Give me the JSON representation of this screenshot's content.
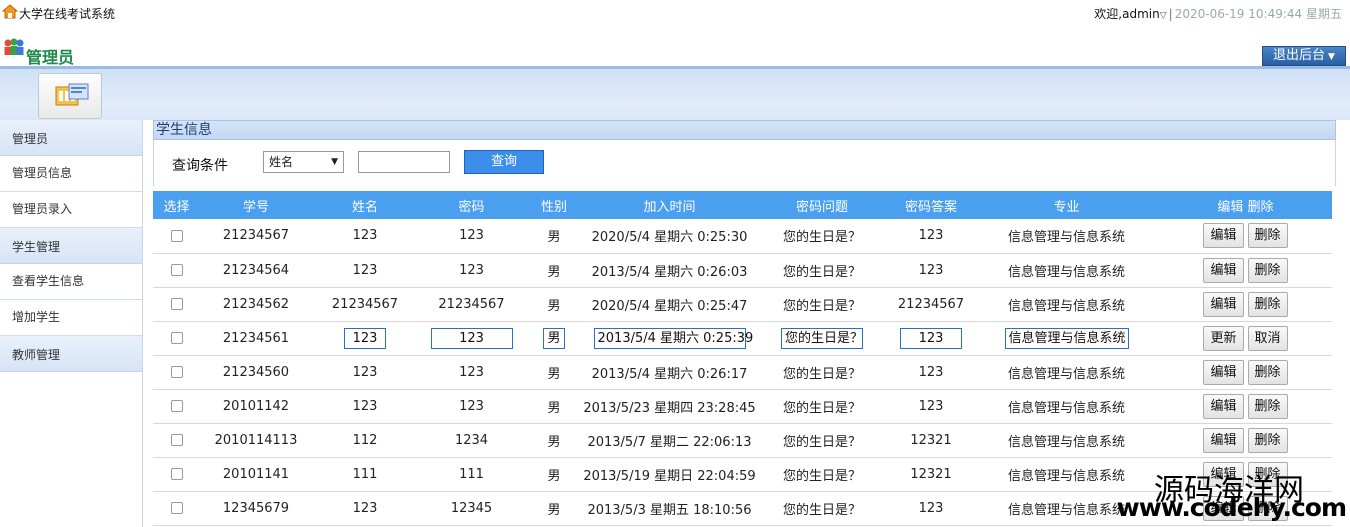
{
  "topbar": {
    "system_title": "大学在线考试系统",
    "welcome": "欢迎,",
    "username": "admin",
    "separator": "|",
    "datetime": "2020-06-19 10:49:44",
    "weekday": "星期五"
  },
  "header": {
    "role_title": "管理员",
    "logout_label": "退出后台"
  },
  "sidebar": {
    "groups": [
      {
        "label": "管理员",
        "items": [
          "管理员信息",
          "管理员录入"
        ]
      },
      {
        "label": "学生管理",
        "items": [
          "查看学生信息",
          "增加学生"
        ]
      },
      {
        "label": "教师管理",
        "items": []
      }
    ]
  },
  "panel": {
    "title": "学生信息",
    "query_label": "查询条件",
    "query_field_selected": "姓名",
    "query_value": "",
    "query_button": "查询"
  },
  "table": {
    "columns": [
      "选择",
      "学号",
      "姓名",
      "密码",
      "性别",
      "加入时间",
      "密码问题",
      "密码答案",
      "专业",
      "编辑 删除"
    ],
    "edit_label": "编辑",
    "delete_label": "删除",
    "update_label": "更新",
    "cancel_label": "取消",
    "rows": [
      {
        "id": "21234567",
        "name": "123",
        "password": "123",
        "gender": "男",
        "joined": "2020/5/4 星期六 0:25:30",
        "question": "您的生日是？",
        "answer": "123",
        "major": "信息管理与信息系统",
        "editing": false
      },
      {
        "id": "21234564",
        "name": "123",
        "password": "123",
        "gender": "男",
        "joined": "2013/5/4 星期六 0:26:03",
        "question": "您的生日是？",
        "answer": "123",
        "major": "信息管理与信息系统",
        "editing": false
      },
      {
        "id": "21234562",
        "name": "21234567",
        "password": "21234567",
        "gender": "男",
        "joined": "2020/5/4 星期六 0:25:47",
        "question": "您的生日是？",
        "answer": "21234567",
        "major": "信息管理与信息系统",
        "editing": false
      },
      {
        "id": "21234561",
        "name": "123",
        "password": "123",
        "gender": "男",
        "joined": "2013/5/4 星期六 0:25:39",
        "question": "您的生日是？",
        "answer": "123",
        "major": "信息管理与信息系统",
        "editing": true
      },
      {
        "id": "21234560",
        "name": "123",
        "password": "123",
        "gender": "男",
        "joined": "2013/5/4 星期六 0:26:17",
        "question": "您的生日是？",
        "answer": "123",
        "major": "信息管理与信息系统",
        "editing": false
      },
      {
        "id": "20101142",
        "name": "123",
        "password": "123",
        "gender": "男",
        "joined": "2013/5/23 星期四 23:28:45",
        "question": "您的生日是？",
        "answer": "123",
        "major": "信息管理与信息系统",
        "editing": false
      },
      {
        "id": "2010114113",
        "name": "112",
        "password": "1234",
        "gender": "男",
        "joined": "2013/5/7 星期二 22:06:13",
        "question": "您的生日是？",
        "answer": "12321",
        "major": "信息管理与信息系统",
        "editing": false
      },
      {
        "id": "20101141",
        "name": "111",
        "password": "111",
        "gender": "男",
        "joined": "2013/5/19 星期日 22:04:59",
        "question": "您的生日是？",
        "answer": "12321",
        "major": "信息管理与信息系统",
        "editing": false
      },
      {
        "id": "12345679",
        "name": "123",
        "password": "12345",
        "gender": "男",
        "joined": "2013/5/3 星期五 18:10:56",
        "question": "您的生日是？",
        "answer": "123",
        "major": "信息管理与信息系统",
        "editing": false
      }
    ]
  },
  "watermark": {
    "text": "源码海洋网",
    "url": "www.codehy.com"
  },
  "colors": {
    "table_header": "#4aa0ef",
    "query_button": "#3b8ee9",
    "admin_title": "#1b8a4a",
    "logout_button": "#2a5fa3"
  }
}
